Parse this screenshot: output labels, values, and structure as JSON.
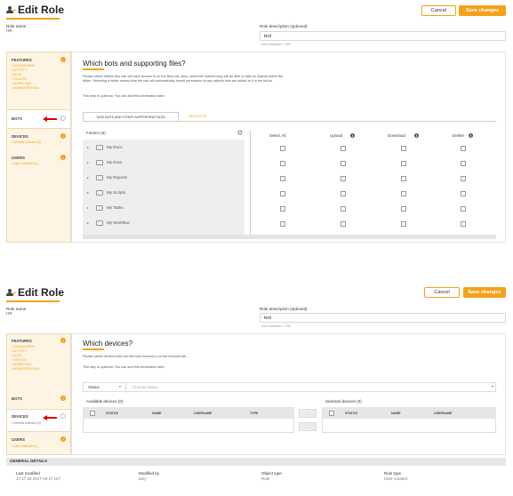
{
  "screen1": {
    "title": "Edit Role",
    "cancel_label": "Cancel",
    "save_label": "Save changes",
    "role_name_label": "Role name",
    "role_name_value": "HR",
    "role_desc_label": "Role description (optional)",
    "role_desc_value": "test",
    "max_chars": "Max characters = 255",
    "sidebar": {
      "features_heading": "FEATURES",
      "features_items": [
        "DASHBOARDS",
        "ACTIVITY",
        "BOTS",
        "DEVICES",
        "WORKLOAD",
        "ADMINISTRATION"
      ],
      "bots_heading": "BOTS",
      "devices_heading": "DEVICES",
      "devices_sub": "Devices selected (0)",
      "users_heading": "USERS",
      "users_sub": "Users selected (1)"
    },
    "main": {
      "heading": "Which bots and supporting files?",
      "para1": "Please select folders this role will have access to on the Bots tab. Also, select the actions they will be able to take on objects within the folder. Selecting a folder means that the role will automatically inherit permission to any objects that are added to it in the future.",
      "para2": "This step is optional. You can add this information later.",
      "tabs": [
        "TASK BOTS AND OTHER SUPPORTING FILES",
        "META BOTS"
      ],
      "folders_header": "Folders (6)",
      "columns": [
        "Select All",
        "Upload",
        "Download",
        "Delete"
      ],
      "folders": [
        "My Docs",
        "My Exes",
        "My Reports",
        "My Scripts",
        "My Tasks",
        "My Workflow"
      ]
    }
  },
  "screen2": {
    "title": "Edit Role",
    "cancel_label": "Cancel",
    "save_label": "Save changes",
    "role_name_label": "Role name",
    "role_name_value": "HR",
    "role_desc_label": "Role description (optional)",
    "role_desc_value": "test",
    "max_chars": "Max characters = 255",
    "sidebar": {
      "features_heading": "FEATURES",
      "features_items": [
        "DASHBOARDS",
        "ACTIVITY",
        "BOTS",
        "DEVICES",
        "WORKLOAD",
        "ADMINISTRATION"
      ],
      "bots_heading": "BOTS",
      "devices_heading": "DEVICES",
      "devices_sub": "Devices selected (0)",
      "users_heading": "USERS",
      "users_sub": "Users selected (1)"
    },
    "main": {
      "heading": "Which devices?",
      "para1": "Please select devices this role will have access to on the Devices tab.",
      "para2": "This step is optional. You can add this information later.",
      "status_label": "Status",
      "status_placeholder": "Choose status",
      "available_header": "Available devices (0)",
      "selected_header": "Selected devices (0)",
      "available_cols": [
        "STATUS",
        "NAME",
        "USERNAME",
        "TYPE"
      ],
      "selected_cols": [
        "STATUS",
        "NAME",
        "USERNAME"
      ]
    },
    "general": {
      "heading": "GENERAL DETAILS",
      "last_modified_label": "Last modified",
      "last_modified_value": "17:27:33 2017-10-27 IST",
      "modified_by_label": "Modified by",
      "modified_by_value": "amy",
      "object_type_label": "Object type",
      "object_type_value": "Role",
      "role_type_label": "Role type",
      "role_type_value": "User-created"
    }
  },
  "colors": {
    "accent": "#f4a11a",
    "sidebar_bg": "#fdf4e3",
    "arrow": "#dd0000"
  }
}
